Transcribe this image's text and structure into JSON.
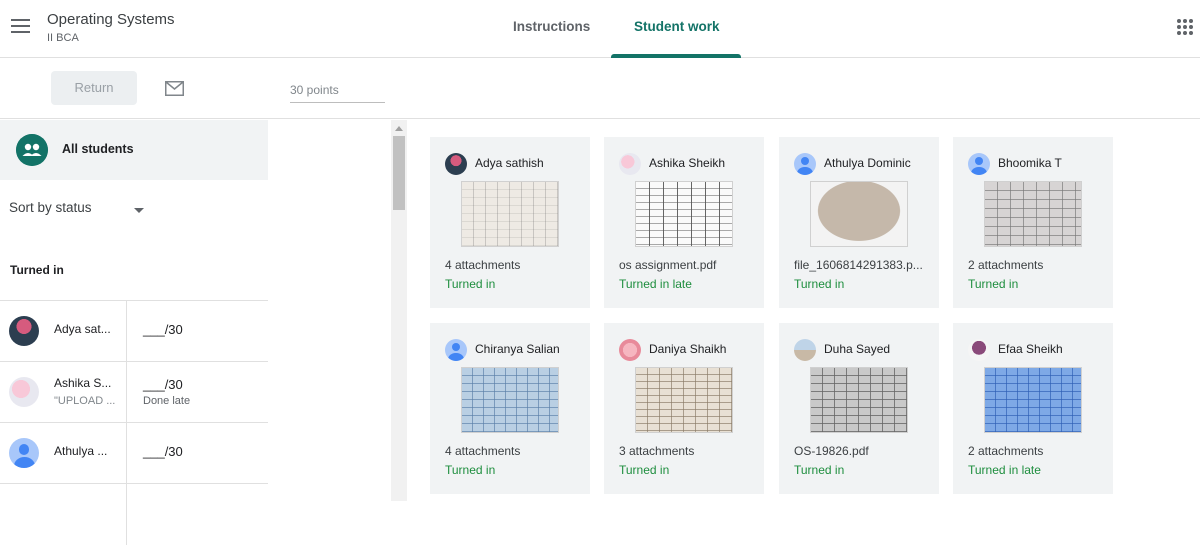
{
  "header": {
    "class_title": "Operating Systems",
    "class_section": "II BCA",
    "tabs": [
      {
        "label": "Instructions",
        "active": false
      },
      {
        "label": "Student work",
        "active": true
      }
    ],
    "accent_color": "#137367"
  },
  "toolbar": {
    "return_label": "Return",
    "points_value": "30 points"
  },
  "sidebar": {
    "all_students_label": "All students",
    "sort_label": "Sort by status",
    "section_heading": "Turned in",
    "students": [
      {
        "name": "Adya sat...",
        "comment": "",
        "grade": "___/30",
        "grade_status": ""
      },
      {
        "name": "Ashika S...",
        "comment": "\"UPLOAD ...",
        "grade": "___/30",
        "grade_status": "Done late"
      },
      {
        "name": "Athulya ...",
        "comment": "",
        "grade": "___/30",
        "grade_status": ""
      }
    ]
  },
  "cards": [
    {
      "name": "Adya sathish",
      "file": "4 attachments",
      "status": "Turned in"
    },
    {
      "name": "Ashika Sheikh",
      "file": "os assignment.pdf",
      "status": "Turned in late"
    },
    {
      "name": "Athulya Dominic",
      "file": "file_1606814291383.p...",
      "status": "Turned in"
    },
    {
      "name": "Bhoomika T",
      "file": "2 attachments",
      "status": "Turned in"
    },
    {
      "name": "Chiranya Salian",
      "file": "4 attachments",
      "status": "Turned in"
    },
    {
      "name": "Daniya Shaikh",
      "file": "3 attachments",
      "status": "Turned in"
    },
    {
      "name": "Duha Sayed",
      "file": "OS-19826.pdf",
      "status": "Turned in"
    },
    {
      "name": "Efaa Sheikh",
      "file": "2 attachments",
      "status": "Turned in late"
    }
  ]
}
